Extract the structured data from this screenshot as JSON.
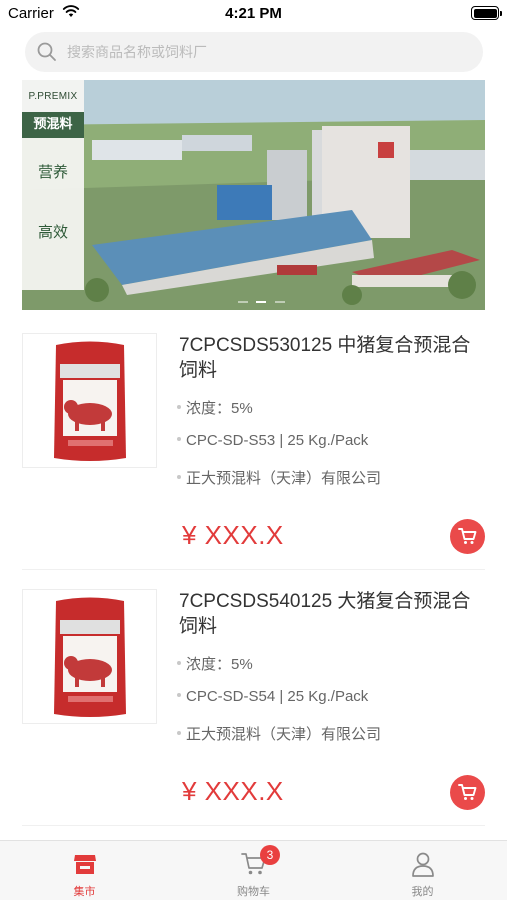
{
  "status_bar": {
    "carrier": "Carrier",
    "time": "4:21 PM"
  },
  "search": {
    "placeholder": "搜索商品名称或饲料厂",
    "value": ""
  },
  "banner": {
    "brand": "P.PREMIX",
    "product": "预混料",
    "words": [
      "营养",
      "高效"
    ]
  },
  "products": [
    {
      "title": "7CPCSDS530125 中猪复合预混合饲料",
      "concentration": "浓度：5%",
      "spec": "CPC-SD-S53 | 25 Kg./Pack",
      "company": "正大预混料（天津）有限公司",
      "price": "¥ XXX.X"
    },
    {
      "title": "7CPCSDS540125 大猪复合预混合饲料",
      "concentration": "浓度：5%",
      "spec": "CPC-SD-S54 | 25 Kg./Pack",
      "company": "正大预混料（天津）有限公司",
      "price": "¥ XXX.X"
    }
  ],
  "tab_bar": {
    "tabs": [
      {
        "label": "集市",
        "icon": "shop-icon",
        "active": true
      },
      {
        "label": "购物车",
        "icon": "cart-icon",
        "badge": "3"
      },
      {
        "label": "我的",
        "icon": "user-icon"
      }
    ]
  },
  "colors": {
    "accent": "#e23b3b",
    "banner_green": "#3d6446"
  }
}
